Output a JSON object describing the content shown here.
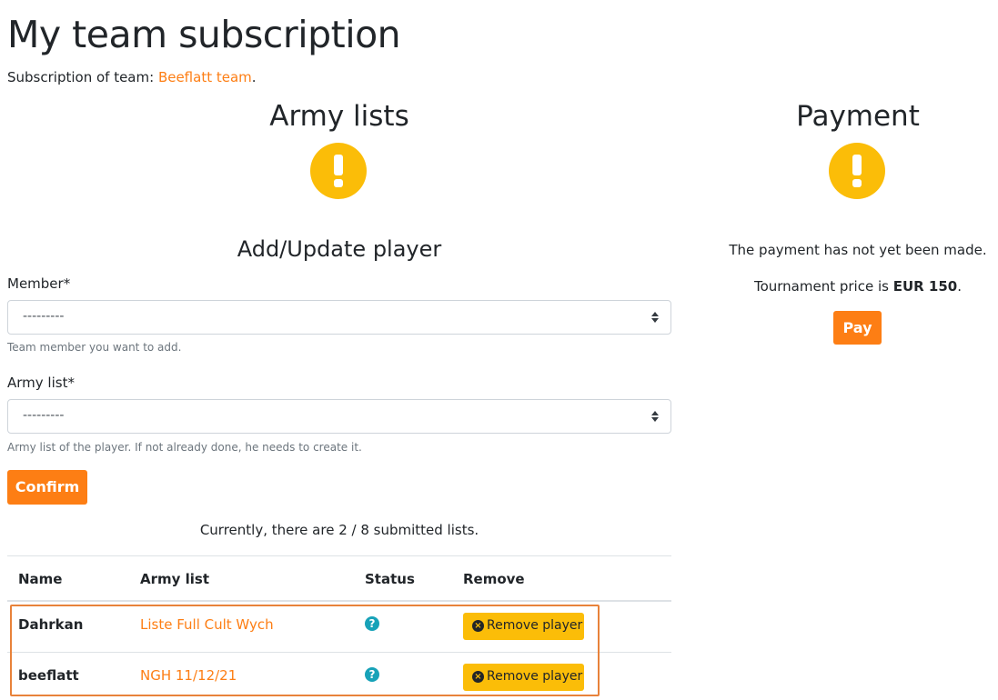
{
  "page": {
    "title": "My team subscription",
    "subscription_prefix": "Subscription of team: ",
    "team_name": "Beeflatt team",
    "subscription_suffix": "."
  },
  "army_section": {
    "title": "Army lists",
    "status_icon": "exclamation-circle-icon"
  },
  "payment_section": {
    "title": "Payment",
    "status_icon": "exclamation-circle-icon",
    "status_text": "The payment has not yet been made.",
    "price_prefix": "Tournament price is ",
    "price_value": "EUR 150",
    "price_suffix": ".",
    "pay_label": "Pay"
  },
  "form": {
    "title": "Add/Update player",
    "member_label": "Member*",
    "member_value": "---------",
    "member_help": "Team member you want to add.",
    "army_label": "Army list*",
    "army_value": "---------",
    "army_help": "Army list of the player. If not already done, he needs to create it.",
    "confirm_label": "Confirm"
  },
  "summary": {
    "text": "Currently, there are 2 / 8 submitted lists."
  },
  "table": {
    "headers": [
      "Name",
      "Army list",
      "Status",
      "Remove"
    ],
    "rows": [
      {
        "name": "Dahrkan",
        "army_list": "Liste Full Cult Wych",
        "status_icon": "question-circle-icon",
        "remove_label": "Remove player"
      },
      {
        "name": "beeflatt",
        "army_list": "NGH 11/12/21",
        "status_icon": "question-circle-icon",
        "remove_label": "Remove player"
      }
    ]
  },
  "colors": {
    "accent": "#fd7e14",
    "warning": "#fbbd08",
    "info": "#17a2b8",
    "highlight_border": "#e8823a"
  }
}
